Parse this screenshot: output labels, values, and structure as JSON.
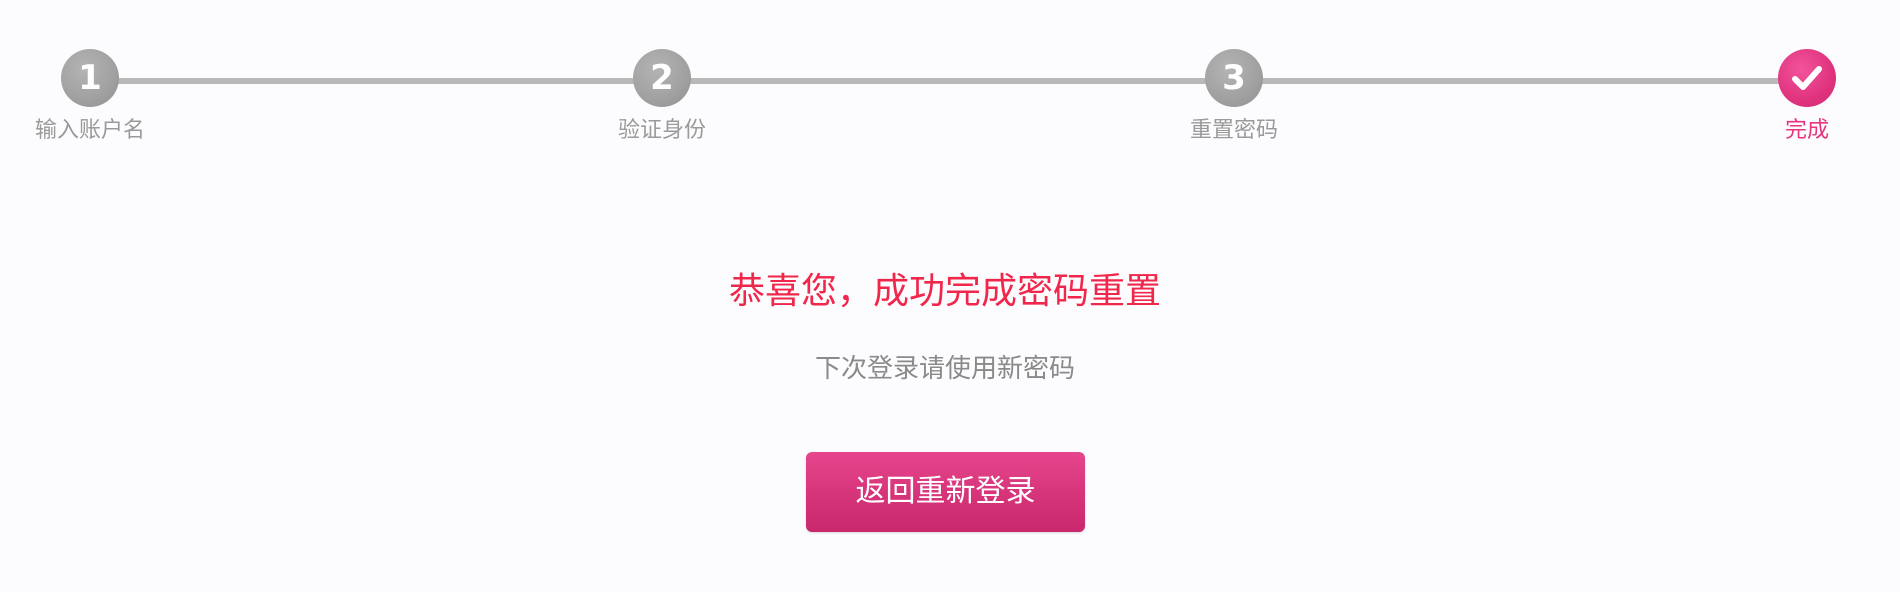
{
  "stepper": {
    "steps": [
      {
        "number": "1",
        "label": "输入账户名",
        "state": "completed"
      },
      {
        "number": "2",
        "label": "验证身份",
        "state": "completed"
      },
      {
        "number": "3",
        "label": "重置密码",
        "state": "completed"
      },
      {
        "number": "",
        "label": "完成",
        "state": "current",
        "icon": "checkmark-icon"
      }
    ]
  },
  "message": {
    "title": "恭喜您，成功完成密码重置",
    "subtitle": "下次登录请使用新密码"
  },
  "actions": {
    "relogin_label": "返回重新登录"
  },
  "colors": {
    "accent": "#e0337e",
    "title": "#f0264b",
    "inactive": "#a2a2a2"
  }
}
